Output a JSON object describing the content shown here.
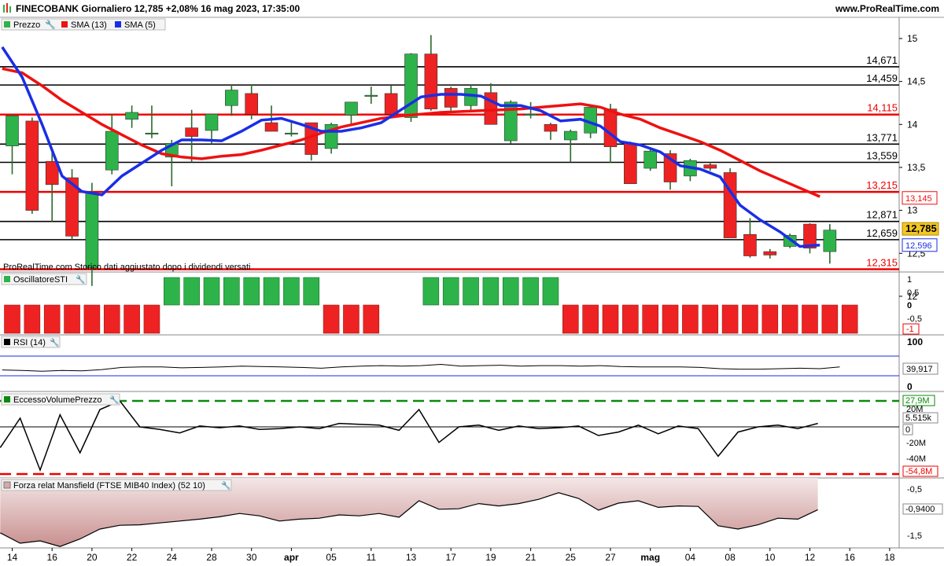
{
  "header": {
    "title": "FINECOBANK Giornaliero 12,785 +2,08% 16 mag 2023, 17:35:00",
    "site": "www.ProRealTime.com"
  },
  "colors": {
    "bull": "#2db34a",
    "bear": "#ee2222",
    "sma13": "#ee1111",
    "sma5": "#1a2ee6",
    "level_black": "#000000",
    "level_red": "#ee0000",
    "price_badge": "#f3c623",
    "mansfield_fill": "#d9a8a8"
  },
  "main_panel": {
    "legend": [
      "Prezzo",
      "SMA (13)",
      "SMA (5)"
    ],
    "footnote": "ProRealTime.com  Storico dati aggiustato dopo i dividendi versati",
    "y_ticks": [
      "15",
      "14,5",
      "14",
      "13,5",
      "13",
      "12,5",
      "12"
    ],
    "levels": [
      {
        "label": "14,671",
        "value": 14.671,
        "color": "black"
      },
      {
        "label": "14,459",
        "value": 14.459,
        "color": "black"
      },
      {
        "label": "14,115",
        "value": 14.115,
        "color": "red"
      },
      {
        "label": "13,771",
        "value": 13.771,
        "color": "black"
      },
      {
        "label": "13,559",
        "value": 13.559,
        "color": "black"
      },
      {
        "label": "13,215",
        "value": 13.215,
        "color": "red"
      },
      {
        "label": "12,871",
        "value": 12.871,
        "color": "black"
      },
      {
        "label": "12,659",
        "value": 12.659,
        "color": "black"
      },
      {
        "label": "12,315",
        "value": 12.315,
        "color": "red"
      }
    ],
    "badges": [
      {
        "label": "13,145",
        "value": 13.145,
        "style": "red"
      },
      {
        "label": "12,785",
        "value": 12.785,
        "style": "yellow"
      },
      {
        "label": "12,596",
        "value": 12.596,
        "style": "blue"
      }
    ]
  },
  "sti_panel": {
    "legend": "OscillatoreSTI",
    "y_ticks": [
      "1",
      "0,5",
      "0",
      "-0,5"
    ],
    "badge": "-1"
  },
  "rsi_panel": {
    "legend": "RSI (14)",
    "y_ticks": [
      "100",
      "0"
    ],
    "badge": "39,917"
  },
  "evp_panel": {
    "legend": "EccessoVolumePrezzo",
    "y_ticks": [
      "20M",
      "0",
      "-20M",
      "-40M"
    ],
    "badges": [
      "27,9M",
      "5.515k",
      "0",
      "-54,8M"
    ]
  },
  "mansfield_panel": {
    "legend": "Forza relat Mansfield (FTSE MIB40 Index) (52 10)",
    "y_ticks": [
      "-0,5",
      "-1,5"
    ],
    "badge": "-0,9400"
  },
  "x_axis": {
    "labels": [
      "14",
      "16",
      "20",
      "22",
      "24",
      "28",
      "30",
      "apr",
      "05",
      "11",
      "13",
      "17",
      "19",
      "21",
      "25",
      "27",
      "mag",
      "04",
      "08",
      "10",
      "12",
      "16",
      "18"
    ]
  },
  "chart_data": {
    "type": "candlestick",
    "title": "FINECOBANK Giornaliero",
    "candles": [
      {
        "o": 13.75,
        "h": 14.12,
        "l": 13.42,
        "c": 14.1
      },
      {
        "o": 14.04,
        "h": 14.08,
        "l": 12.96,
        "c": 13.0
      },
      {
        "o": 13.57,
        "h": 13.72,
        "l": 12.87,
        "c": 13.3
      },
      {
        "o": 13.38,
        "h": 13.48,
        "l": 12.66,
        "c": 12.7
      },
      {
        "o": 12.33,
        "h": 13.32,
        "l": 12.12,
        "c": 13.2
      },
      {
        "o": 13.47,
        "h": 14.12,
        "l": 13.42,
        "c": 13.92
      },
      {
        "o": 14.06,
        "h": 14.22,
        "l": 13.96,
        "c": 14.14
      },
      {
        "o": 13.9,
        "h": 14.22,
        "l": 13.84,
        "c": 13.9
      },
      {
        "o": 13.62,
        "h": 13.82,
        "l": 13.28,
        "c": 13.78
      },
      {
        "o": 13.96,
        "h": 14.17,
        "l": 13.56,
        "c": 13.86
      },
      {
        "o": 13.93,
        "h": 14.12,
        "l": 13.77,
        "c": 14.12
      },
      {
        "o": 14.22,
        "h": 14.46,
        "l": 14.1,
        "c": 14.4
      },
      {
        "o": 14.36,
        "h": 14.46,
        "l": 14.06,
        "c": 14.12
      },
      {
        "o": 14.02,
        "h": 14.22,
        "l": 13.92,
        "c": 13.92
      },
      {
        "o": 13.9,
        "h": 14.02,
        "l": 13.86,
        "c": 13.9
      },
      {
        "o": 14.02,
        "h": 14.02,
        "l": 13.58,
        "c": 13.65
      },
      {
        "o": 13.72,
        "h": 14.02,
        "l": 13.66,
        "c": 14.0
      },
      {
        "o": 14.11,
        "h": 14.26,
        "l": 14.01,
        "c": 14.26
      },
      {
        "o": 14.34,
        "h": 14.44,
        "l": 14.24,
        "c": 14.34
      },
      {
        "o": 14.36,
        "h": 14.45,
        "l": 14.12,
        "c": 14.12
      },
      {
        "o": 14.08,
        "h": 14.83,
        "l": 14.03,
        "c": 14.82
      },
      {
        "o": 14.82,
        "h": 15.04,
        "l": 14.16,
        "c": 14.18
      },
      {
        "o": 14.42,
        "h": 14.44,
        "l": 14.16,
        "c": 14.2
      },
      {
        "o": 14.22,
        "h": 14.46,
        "l": 14.16,
        "c": 14.42
      },
      {
        "o": 14.37,
        "h": 14.48,
        "l": 14.0,
        "c": 14.0
      },
      {
        "o": 13.81,
        "h": 14.28,
        "l": 13.78,
        "c": 14.26
      },
      {
        "o": 14.12,
        "h": 14.26,
        "l": 14.07,
        "c": 14.12
      },
      {
        "o": 14.0,
        "h": 14.02,
        "l": 13.82,
        "c": 13.92
      },
      {
        "o": 13.82,
        "h": 13.94,
        "l": 13.56,
        "c": 13.92
      },
      {
        "o": 13.9,
        "h": 14.22,
        "l": 13.84,
        "c": 14.2
      },
      {
        "o": 14.18,
        "h": 14.24,
        "l": 13.55,
        "c": 13.74
      },
      {
        "o": 13.78,
        "h": 13.8,
        "l": 13.31,
        "c": 13.31
      },
      {
        "o": 13.49,
        "h": 13.72,
        "l": 13.46,
        "c": 13.69
      },
      {
        "o": 13.66,
        "h": 13.7,
        "l": 13.24,
        "c": 13.33
      },
      {
        "o": 13.4,
        "h": 13.6,
        "l": 13.34,
        "c": 13.58
      },
      {
        "o": 13.53,
        "h": 13.56,
        "l": 13.46,
        "c": 13.49
      },
      {
        "o": 13.44,
        "h": 13.49,
        "l": 12.68,
        "c": 12.68
      },
      {
        "o": 12.72,
        "h": 12.91,
        "l": 12.45,
        "c": 12.47
      },
      {
        "o": 12.52,
        "h": 12.55,
        "l": 12.44,
        "c": 12.48
      },
      {
        "o": 12.58,
        "h": 12.73,
        "l": 12.56,
        "c": 12.71
      },
      {
        "o": 12.84,
        "h": 12.85,
        "l": 12.5,
        "c": 12.56
      },
      {
        "o": 12.52,
        "h": 12.84,
        "l": 12.38,
        "c": 12.77
      }
    ],
    "sma13": [
      14.65,
      14.6,
      14.45,
      14.28,
      14.14,
      14.0,
      13.88,
      13.76,
      13.66,
      13.62,
      13.6,
      13.63,
      13.65,
      13.7,
      13.76,
      13.82,
      13.9,
      13.97,
      14.02,
      14.07,
      14.1,
      14.12,
      14.14,
      14.15,
      14.16,
      14.17,
      14.18,
      14.2,
      14.22,
      14.24,
      14.2,
      14.12,
      14.06,
      13.96,
      13.88,
      13.8,
      13.7,
      13.58,
      13.46,
      13.36,
      13.26,
      13.16
    ],
    "sma5": [
      14.9,
      14.55,
      14.0,
      13.4,
      13.22,
      13.18,
      13.4,
      13.55,
      13.7,
      13.82,
      13.82,
      13.81,
      13.92,
      14.05,
      14.07,
      14.0,
      13.92,
      13.92,
      13.96,
      14.02,
      14.17,
      14.32,
      14.35,
      14.35,
      14.33,
      14.22,
      14.22,
      14.16,
      14.04,
      14.06,
      13.98,
      13.8,
      13.76,
      13.68,
      13.52,
      13.48,
      13.39,
      13.06,
      12.89,
      12.75,
      12.58,
      12.596
    ],
    "sti": [
      -1,
      -1,
      -1,
      -1,
      -1,
      -1,
      -1,
      -1,
      1,
      1,
      1,
      1,
      1,
      1,
      1,
      1,
      -1,
      -1,
      -1,
      0,
      0,
      1,
      1,
      1,
      1,
      1,
      1,
      1,
      -1,
      -1,
      -1,
      -1,
      -1,
      -1,
      -1,
      -1,
      -1,
      -1,
      -1,
      -1,
      -1,
      -1,
      -1
    ],
    "rsi": [
      37,
      36,
      34,
      36,
      35,
      38,
      43,
      44,
      44,
      42,
      43,
      44,
      46,
      45,
      44,
      43,
      41,
      44,
      46,
      47,
      46,
      47,
      50,
      46,
      47,
      48,
      46,
      47,
      47,
      46,
      47,
      45,
      44,
      44,
      44,
      43,
      40,
      39,
      39,
      40,
      41,
      40,
      44
    ],
    "evp": [
      -12,
      5,
      -25,
      7,
      -15,
      10,
      15,
      0,
      -1.5,
      -3.5,
      0.5,
      -0.5,
      0.5,
      -1.5,
      -1,
      0,
      -1,
      2,
      1.5,
      1,
      -2,
      10,
      -9,
      0,
      1,
      -2,
      0.5,
      -1,
      -0.5,
      0.5,
      -5,
      -3,
      1,
      -4,
      0.5,
      -1,
      -17,
      -3,
      0,
      1,
      -1,
      2
    ],
    "mansfield": [
      -1.43,
      -1.65,
      -1.6,
      -1.72,
      -1.56,
      -1.35,
      -1.27,
      -1.26,
      -1.22,
      -1.18,
      -1.14,
      -1.09,
      -1.02,
      -1.07,
      -1.18,
      -1.14,
      -1.12,
      -1.05,
      -1.07,
      -1.02,
      -1.1,
      -0.75,
      -0.93,
      -0.92,
      -0.81,
      -0.86,
      -0.81,
      -0.72,
      -0.58,
      -0.7,
      -0.95,
      -0.8,
      -0.75,
      -0.89,
      -0.86,
      -0.87,
      -1.28,
      -1.35,
      -1.26,
      -1.12,
      -1.14,
      -0.94
    ]
  }
}
